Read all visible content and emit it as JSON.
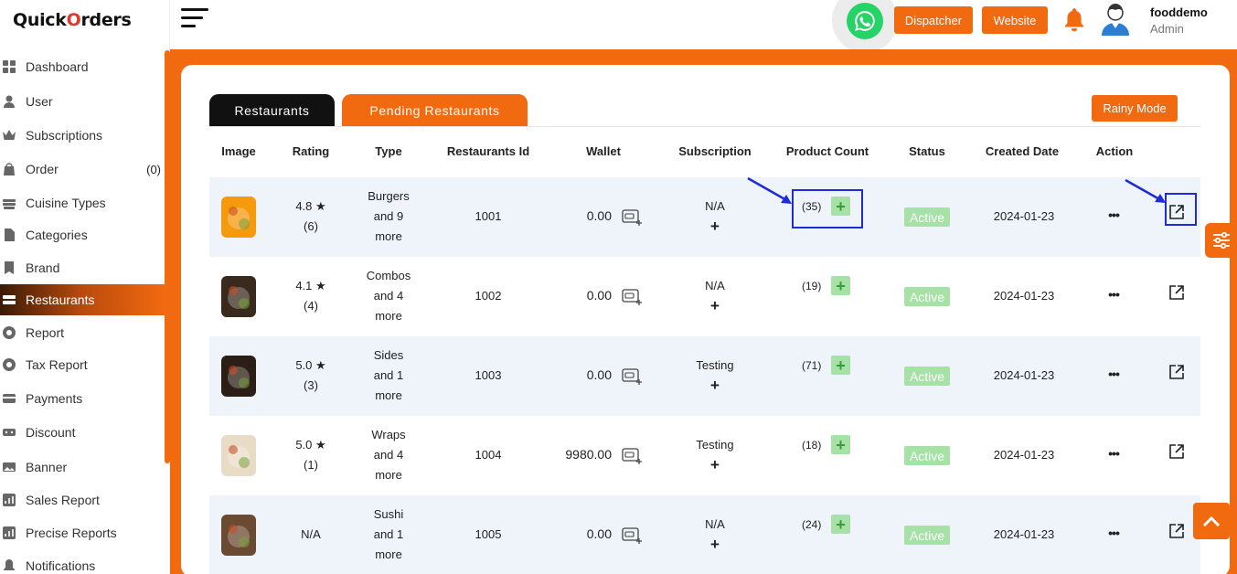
{
  "brand": {
    "logo_part1": "Quick",
    "logo_o": "O",
    "logo_part2": "rders"
  },
  "sidebar": {
    "items": [
      {
        "label": "Dashboard",
        "icon": "grid-icon"
      },
      {
        "label": "User",
        "icon": "user-icon"
      },
      {
        "label": "Subscriptions",
        "icon": "crown-icon"
      },
      {
        "label": "Order",
        "icon": "bag-icon",
        "count": "(0)"
      },
      {
        "label": "Cuisine Types",
        "icon": "cuisine-icon"
      },
      {
        "label": "Categories",
        "icon": "category-icon"
      },
      {
        "label": "Brand",
        "icon": "brand-icon"
      },
      {
        "label": "Restaurants",
        "icon": "restaurant-icon",
        "active": true
      },
      {
        "label": "Report",
        "icon": "report-icon"
      },
      {
        "label": "Tax Report",
        "icon": "tax-report-icon"
      },
      {
        "label": "Payments",
        "icon": "payments-icon"
      },
      {
        "label": "Discount",
        "icon": "discount-icon"
      },
      {
        "label": "Banner",
        "icon": "banner-icon"
      },
      {
        "label": "Sales Report",
        "icon": "sales-report-icon"
      },
      {
        "label": "Precise Reports",
        "icon": "precise-report-icon"
      },
      {
        "label": "Notifications",
        "icon": "notification-icon"
      }
    ]
  },
  "header": {
    "dispatcher_label": "Dispatcher",
    "website_label": "Website",
    "user_name": "fooddemo",
    "user_role": "Admin"
  },
  "tabs": {
    "restaurants": "Restaurants",
    "pending": "Pending Restaurants"
  },
  "rainy_mode_label": "Rainy Mode",
  "table": {
    "headers": [
      "Image",
      "Rating",
      "Type",
      "Restaurants Id",
      "Wallet",
      "Subscription",
      "Product Count",
      "Status",
      "Created Date",
      "Action"
    ],
    "rows": [
      {
        "rating": "4.8",
        "reviews": "(6)",
        "type1": "Burgers",
        "type2": "and 9",
        "type3": "more",
        "id": "1001",
        "wallet": "0.00",
        "subscription": "N/A",
        "product_count": "(35)",
        "status": "Active",
        "created": "2024-01-23",
        "thumb_color": "#f59a0c"
      },
      {
        "rating": "4.1",
        "reviews": "(4)",
        "type1": "Combos",
        "type2": "and 4",
        "type3": "more",
        "id": "1002",
        "wallet": "0.00",
        "subscription": "N/A",
        "product_count": "(19)",
        "status": "Active",
        "created": "2024-01-23",
        "thumb_color": "#3a2a1e"
      },
      {
        "rating": "5.0",
        "reviews": "(3)",
        "type1": "Sides",
        "type2": "and 1",
        "type3": "more",
        "id": "1003",
        "wallet": "0.00",
        "subscription": "Testing",
        "product_count": "(71)",
        "status": "Active",
        "created": "2024-01-23",
        "thumb_color": "#2b1e16"
      },
      {
        "rating": "5.0",
        "reviews": "(1)",
        "type1": "Wraps",
        "type2": "and 4",
        "type3": "more",
        "id": "1004",
        "wallet": "9980.00",
        "subscription": "Testing",
        "product_count": "(18)",
        "status": "Active",
        "created": "2024-01-23",
        "thumb_color": "#e9dcc6"
      },
      {
        "rating": "N/A",
        "reviews": "",
        "type1": "Sushi",
        "type2": "and 1",
        "type3": "more",
        "id": "1005",
        "wallet": "0.00",
        "subscription": "N/A",
        "product_count": "(24)",
        "status": "Active",
        "created": "2024-01-23",
        "thumb_color": "#6b4a32"
      }
    ],
    "plus_symbol": "+",
    "dots_symbol": "•••",
    "star_symbol": "★"
  },
  "colors": {
    "accent": "#f26a10",
    "active_badge": "#a6e1a6",
    "highlight": "#1f2bd6"
  }
}
